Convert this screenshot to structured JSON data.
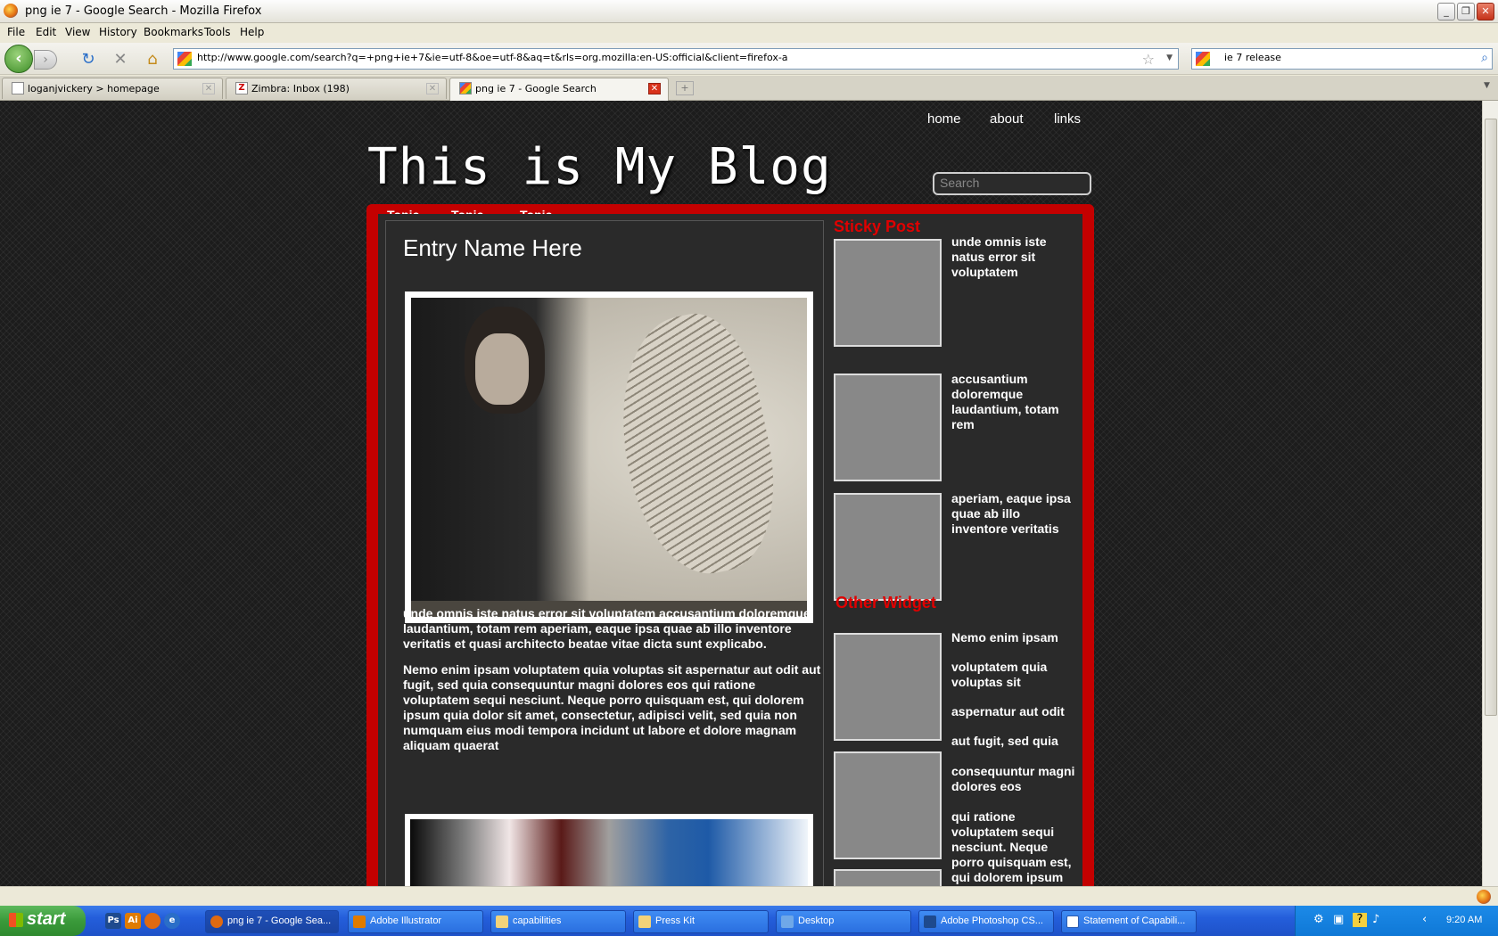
{
  "window": {
    "title": "png ie 7 - Google Search - Mozilla Firefox"
  },
  "menu": [
    "File",
    "Edit",
    "View",
    "History",
    "Bookmarks",
    "Tools",
    "Help"
  ],
  "nav": {
    "url": "http://www.google.com/search?q=+png+ie+7&ie=utf-8&oe=utf-8&aq=t&rls=org.mozilla:en-US:official&client=firefox-a",
    "search_value": "ie 7 release"
  },
  "tabs": [
    {
      "label": "loganjvickery > homepage"
    },
    {
      "label": "Zimbra: Inbox (198)"
    },
    {
      "label": "png ie 7 - Google Search"
    }
  ],
  "blog": {
    "nav": [
      "home",
      "about",
      "links"
    ],
    "title": "This is My Blog",
    "search_placeholder": "Search",
    "topics": [
      "Topic",
      "Topic",
      "Topic"
    ],
    "entry_title": "Entry Name Here",
    "para1": "unde omnis iste natus error sit voluptatem  accusantium doloremque laudantium, totam rem aperiam, eaque ipsa quae ab illo inventore veritatis  et quasi architecto beatae vitae dicta sunt explicabo.",
    "para2": " Nemo enim ipsam voluptatem quia voluptas sit aspernatur aut odit aut fugit, sed quia  consequuntur magni dolores eos qui ratione voluptatem sequi nesciunt. Neque porro quisquam est, qui dolorem ipsum quia dolor sit amet, consectetur, adipisci velit, sed quia non numquam eius modi tempora incidunt ut labore et dolore magnam aliquam quaerat",
    "sticky_heading": "Sticky Post",
    "sticky_items": [
      "unde omnis iste natus error sit voluptatem",
      " accusantium doloremque laudantium, totam rem",
      " aperiam, eaque ipsa quae  ab illo inventore veritatis"
    ],
    "widget_heading": "Other Widget",
    "widget_text1": " Nemo enim ipsam",
    "widget_text2": " voluptatem quia voluptas sit",
    "widget_text3": " aspernatur aut odit",
    "widget_text4": " aut fugit, sed quia",
    "widget_text5": " consequuntur magni dolores eos",
    "widget_text6": " qui ratione voluptatem sequi nesciunt. Neque porro quisquam est, qui dolorem ipsum"
  },
  "taskbar": {
    "start": "start",
    "tasks": [
      "png ie 7 - Google Sea...",
      "Adobe Illustrator",
      "capabilities",
      "Press Kit",
      "Desktop",
      "Adobe Photoshop CS...",
      "Statement of Capabili..."
    ],
    "clock": "9:20 AM"
  }
}
